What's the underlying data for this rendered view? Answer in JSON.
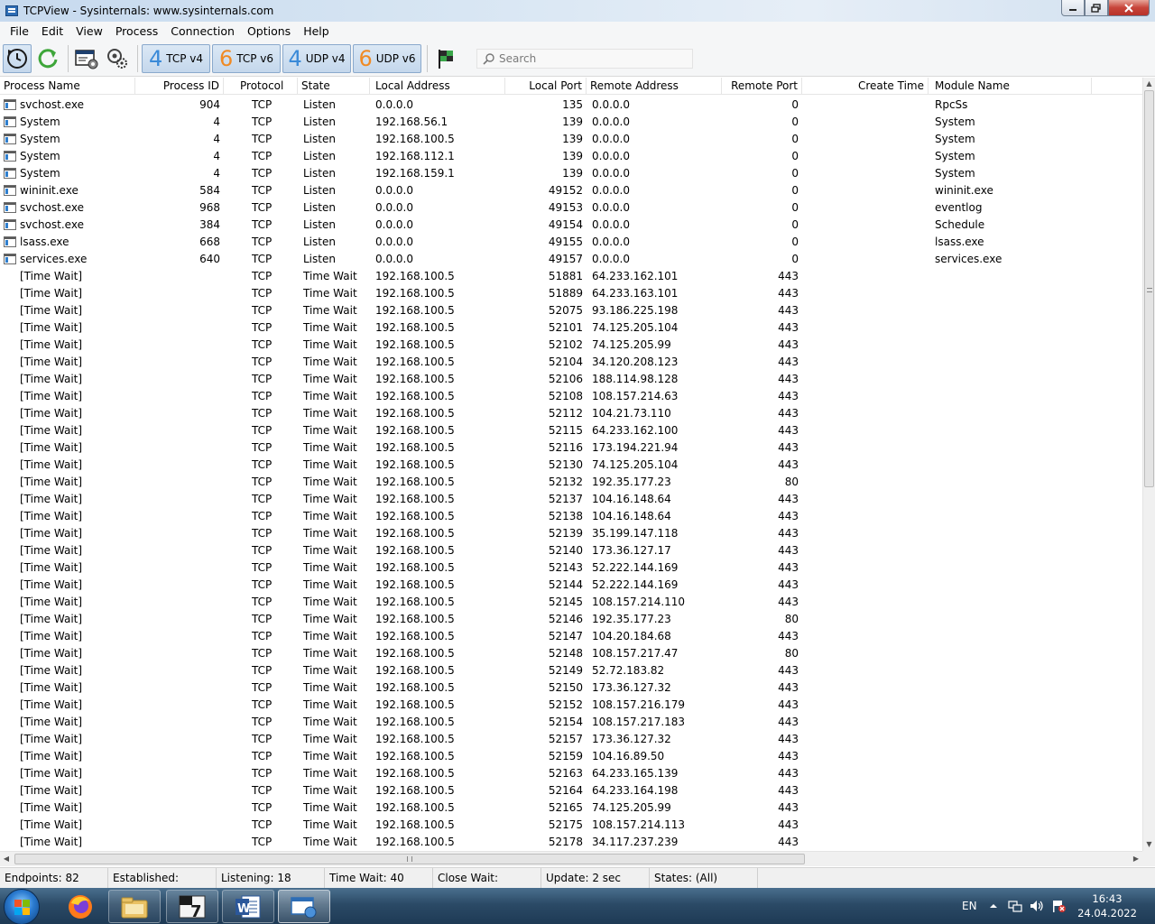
{
  "window": {
    "title": "TCPView - Sysinternals: www.sysinternals.com"
  },
  "menu": [
    "File",
    "Edit",
    "View",
    "Process",
    "Connection",
    "Options",
    "Help"
  ],
  "toolbar": {
    "tcp4": {
      "num": "4",
      "label": "TCP v4"
    },
    "tcp6": {
      "num": "6",
      "label": "TCP v6"
    },
    "udp4": {
      "num": "4",
      "label": "UDP v4"
    },
    "udp6": {
      "num": "6",
      "label": "UDP v6"
    },
    "search_placeholder": "Search"
  },
  "columns": {
    "process_name": "Process Name",
    "process_id": "Process ID",
    "protocol": "Protocol",
    "state": "State",
    "local_address": "Local Address",
    "local_port": "Local Port",
    "remote_address": "Remote Address",
    "remote_port": "Remote Port",
    "create_time": "Create Time",
    "module_name": "Module Name"
  },
  "rows": [
    {
      "icon": true,
      "name": "svchost.exe",
      "pid": "904",
      "proto": "TCP",
      "state": "Listen",
      "laddr": "0.0.0.0",
      "lport": "135",
      "raddr": "0.0.0.0",
      "rport": "0",
      "ctime": "",
      "module": "RpcSs"
    },
    {
      "icon": true,
      "name": "System",
      "pid": "4",
      "proto": "TCP",
      "state": "Listen",
      "laddr": "192.168.56.1",
      "lport": "139",
      "raddr": "0.0.0.0",
      "rport": "0",
      "ctime": "",
      "module": "System"
    },
    {
      "icon": true,
      "name": "System",
      "pid": "4",
      "proto": "TCP",
      "state": "Listen",
      "laddr": "192.168.100.5",
      "lport": "139",
      "raddr": "0.0.0.0",
      "rport": "0",
      "ctime": "",
      "module": "System"
    },
    {
      "icon": true,
      "name": "System",
      "pid": "4",
      "proto": "TCP",
      "state": "Listen",
      "laddr": "192.168.112.1",
      "lport": "139",
      "raddr": "0.0.0.0",
      "rport": "0",
      "ctime": "",
      "module": "System"
    },
    {
      "icon": true,
      "name": "System",
      "pid": "4",
      "proto": "TCP",
      "state": "Listen",
      "laddr": "192.168.159.1",
      "lport": "139",
      "raddr": "0.0.0.0",
      "rport": "0",
      "ctime": "",
      "module": "System"
    },
    {
      "icon": true,
      "name": "wininit.exe",
      "pid": "584",
      "proto": "TCP",
      "state": "Listen",
      "laddr": "0.0.0.0",
      "lport": "49152",
      "raddr": "0.0.0.0",
      "rport": "0",
      "ctime": "",
      "module": "wininit.exe"
    },
    {
      "icon": true,
      "name": "svchost.exe",
      "pid": "968",
      "proto": "TCP",
      "state": "Listen",
      "laddr": "0.0.0.0",
      "lport": "49153",
      "raddr": "0.0.0.0",
      "rport": "0",
      "ctime": "",
      "module": "eventlog"
    },
    {
      "icon": true,
      "name": "svchost.exe",
      "pid": "384",
      "proto": "TCP",
      "state": "Listen",
      "laddr": "0.0.0.0",
      "lport": "49154",
      "raddr": "0.0.0.0",
      "rport": "0",
      "ctime": "",
      "module": "Schedule"
    },
    {
      "icon": true,
      "name": "lsass.exe",
      "pid": "668",
      "proto": "TCP",
      "state": "Listen",
      "laddr": "0.0.0.0",
      "lport": "49155",
      "raddr": "0.0.0.0",
      "rport": "0",
      "ctime": "",
      "module": "lsass.exe"
    },
    {
      "icon": true,
      "name": "services.exe",
      "pid": "640",
      "proto": "TCP",
      "state": "Listen",
      "laddr": "0.0.0.0",
      "lport": "49157",
      "raddr": "0.0.0.0",
      "rport": "0",
      "ctime": "",
      "module": "services.exe"
    },
    {
      "icon": false,
      "name": "[Time Wait]",
      "pid": "",
      "proto": "TCP",
      "state": "Time Wait",
      "laddr": "192.168.100.5",
      "lport": "51881",
      "raddr": "64.233.162.101",
      "rport": "443",
      "ctime": "",
      "module": ""
    },
    {
      "icon": false,
      "name": "[Time Wait]",
      "pid": "",
      "proto": "TCP",
      "state": "Time Wait",
      "laddr": "192.168.100.5",
      "lport": "51889",
      "raddr": "64.233.163.101",
      "rport": "443",
      "ctime": "",
      "module": ""
    },
    {
      "icon": false,
      "name": "[Time Wait]",
      "pid": "",
      "proto": "TCP",
      "state": "Time Wait",
      "laddr": "192.168.100.5",
      "lport": "52075",
      "raddr": "93.186.225.198",
      "rport": "443",
      "ctime": "",
      "module": ""
    },
    {
      "icon": false,
      "name": "[Time Wait]",
      "pid": "",
      "proto": "TCP",
      "state": "Time Wait",
      "laddr": "192.168.100.5",
      "lport": "52101",
      "raddr": "74.125.205.104",
      "rport": "443",
      "ctime": "",
      "module": ""
    },
    {
      "icon": false,
      "name": "[Time Wait]",
      "pid": "",
      "proto": "TCP",
      "state": "Time Wait",
      "laddr": "192.168.100.5",
      "lport": "52102",
      "raddr": "74.125.205.99",
      "rport": "443",
      "ctime": "",
      "module": ""
    },
    {
      "icon": false,
      "name": "[Time Wait]",
      "pid": "",
      "proto": "TCP",
      "state": "Time Wait",
      "laddr": "192.168.100.5",
      "lport": "52104",
      "raddr": "34.120.208.123",
      "rport": "443",
      "ctime": "",
      "module": ""
    },
    {
      "icon": false,
      "name": "[Time Wait]",
      "pid": "",
      "proto": "TCP",
      "state": "Time Wait",
      "laddr": "192.168.100.5",
      "lport": "52106",
      "raddr": "188.114.98.128",
      "rport": "443",
      "ctime": "",
      "module": ""
    },
    {
      "icon": false,
      "name": "[Time Wait]",
      "pid": "",
      "proto": "TCP",
      "state": "Time Wait",
      "laddr": "192.168.100.5",
      "lport": "52108",
      "raddr": "108.157.214.63",
      "rport": "443",
      "ctime": "",
      "module": ""
    },
    {
      "icon": false,
      "name": "[Time Wait]",
      "pid": "",
      "proto": "TCP",
      "state": "Time Wait",
      "laddr": "192.168.100.5",
      "lport": "52112",
      "raddr": "104.21.73.110",
      "rport": "443",
      "ctime": "",
      "module": ""
    },
    {
      "icon": false,
      "name": "[Time Wait]",
      "pid": "",
      "proto": "TCP",
      "state": "Time Wait",
      "laddr": "192.168.100.5",
      "lport": "52115",
      "raddr": "64.233.162.100",
      "rport": "443",
      "ctime": "",
      "module": ""
    },
    {
      "icon": false,
      "name": "[Time Wait]",
      "pid": "",
      "proto": "TCP",
      "state": "Time Wait",
      "laddr": "192.168.100.5",
      "lport": "52116",
      "raddr": "173.194.221.94",
      "rport": "443",
      "ctime": "",
      "module": ""
    },
    {
      "icon": false,
      "name": "[Time Wait]",
      "pid": "",
      "proto": "TCP",
      "state": "Time Wait",
      "laddr": "192.168.100.5",
      "lport": "52130",
      "raddr": "74.125.205.104",
      "rport": "443",
      "ctime": "",
      "module": ""
    },
    {
      "icon": false,
      "name": "[Time Wait]",
      "pid": "",
      "proto": "TCP",
      "state": "Time Wait",
      "laddr": "192.168.100.5",
      "lport": "52132",
      "raddr": "192.35.177.23",
      "rport": "80",
      "ctime": "",
      "module": ""
    },
    {
      "icon": false,
      "name": "[Time Wait]",
      "pid": "",
      "proto": "TCP",
      "state": "Time Wait",
      "laddr": "192.168.100.5",
      "lport": "52137",
      "raddr": "104.16.148.64",
      "rport": "443",
      "ctime": "",
      "module": ""
    },
    {
      "icon": false,
      "name": "[Time Wait]",
      "pid": "",
      "proto": "TCP",
      "state": "Time Wait",
      "laddr": "192.168.100.5",
      "lport": "52138",
      "raddr": "104.16.148.64",
      "rport": "443",
      "ctime": "",
      "module": ""
    },
    {
      "icon": false,
      "name": "[Time Wait]",
      "pid": "",
      "proto": "TCP",
      "state": "Time Wait",
      "laddr": "192.168.100.5",
      "lport": "52139",
      "raddr": "35.199.147.118",
      "rport": "443",
      "ctime": "",
      "module": ""
    },
    {
      "icon": false,
      "name": "[Time Wait]",
      "pid": "",
      "proto": "TCP",
      "state": "Time Wait",
      "laddr": "192.168.100.5",
      "lport": "52140",
      "raddr": "173.36.127.17",
      "rport": "443",
      "ctime": "",
      "module": ""
    },
    {
      "icon": false,
      "name": "[Time Wait]",
      "pid": "",
      "proto": "TCP",
      "state": "Time Wait",
      "laddr": "192.168.100.5",
      "lport": "52143",
      "raddr": "52.222.144.169",
      "rport": "443",
      "ctime": "",
      "module": ""
    },
    {
      "icon": false,
      "name": "[Time Wait]",
      "pid": "",
      "proto": "TCP",
      "state": "Time Wait",
      "laddr": "192.168.100.5",
      "lport": "52144",
      "raddr": "52.222.144.169",
      "rport": "443",
      "ctime": "",
      "module": ""
    },
    {
      "icon": false,
      "name": "[Time Wait]",
      "pid": "",
      "proto": "TCP",
      "state": "Time Wait",
      "laddr": "192.168.100.5",
      "lport": "52145",
      "raddr": "108.157.214.110",
      "rport": "443",
      "ctime": "",
      "module": ""
    },
    {
      "icon": false,
      "name": "[Time Wait]",
      "pid": "",
      "proto": "TCP",
      "state": "Time Wait",
      "laddr": "192.168.100.5",
      "lport": "52146",
      "raddr": "192.35.177.23",
      "rport": "80",
      "ctime": "",
      "module": ""
    },
    {
      "icon": false,
      "name": "[Time Wait]",
      "pid": "",
      "proto": "TCP",
      "state": "Time Wait",
      "laddr": "192.168.100.5",
      "lport": "52147",
      "raddr": "104.20.184.68",
      "rport": "443",
      "ctime": "",
      "module": ""
    },
    {
      "icon": false,
      "name": "[Time Wait]",
      "pid": "",
      "proto": "TCP",
      "state": "Time Wait",
      "laddr": "192.168.100.5",
      "lport": "52148",
      "raddr": "108.157.217.47",
      "rport": "80",
      "ctime": "",
      "module": ""
    },
    {
      "icon": false,
      "name": "[Time Wait]",
      "pid": "",
      "proto": "TCP",
      "state": "Time Wait",
      "laddr": "192.168.100.5",
      "lport": "52149",
      "raddr": "52.72.183.82",
      "rport": "443",
      "ctime": "",
      "module": ""
    },
    {
      "icon": false,
      "name": "[Time Wait]",
      "pid": "",
      "proto": "TCP",
      "state": "Time Wait",
      "laddr": "192.168.100.5",
      "lport": "52150",
      "raddr": "173.36.127.32",
      "rport": "443",
      "ctime": "",
      "module": ""
    },
    {
      "icon": false,
      "name": "[Time Wait]",
      "pid": "",
      "proto": "TCP",
      "state": "Time Wait",
      "laddr": "192.168.100.5",
      "lport": "52152",
      "raddr": "108.157.216.179",
      "rport": "443",
      "ctime": "",
      "module": ""
    },
    {
      "icon": false,
      "name": "[Time Wait]",
      "pid": "",
      "proto": "TCP",
      "state": "Time Wait",
      "laddr": "192.168.100.5",
      "lport": "52154",
      "raddr": "108.157.217.183",
      "rport": "443",
      "ctime": "",
      "module": ""
    },
    {
      "icon": false,
      "name": "[Time Wait]",
      "pid": "",
      "proto": "TCP",
      "state": "Time Wait",
      "laddr": "192.168.100.5",
      "lport": "52157",
      "raddr": "173.36.127.32",
      "rport": "443",
      "ctime": "",
      "module": ""
    },
    {
      "icon": false,
      "name": "[Time Wait]",
      "pid": "",
      "proto": "TCP",
      "state": "Time Wait",
      "laddr": "192.168.100.5",
      "lport": "52159",
      "raddr": "104.16.89.50",
      "rport": "443",
      "ctime": "",
      "module": ""
    },
    {
      "icon": false,
      "name": "[Time Wait]",
      "pid": "",
      "proto": "TCP",
      "state": "Time Wait",
      "laddr": "192.168.100.5",
      "lport": "52163",
      "raddr": "64.233.165.139",
      "rport": "443",
      "ctime": "",
      "module": ""
    },
    {
      "icon": false,
      "name": "[Time Wait]",
      "pid": "",
      "proto": "TCP",
      "state": "Time Wait",
      "laddr": "192.168.100.5",
      "lport": "52164",
      "raddr": "64.233.164.198",
      "rport": "443",
      "ctime": "",
      "module": ""
    },
    {
      "icon": false,
      "name": "[Time Wait]",
      "pid": "",
      "proto": "TCP",
      "state": "Time Wait",
      "laddr": "192.168.100.5",
      "lport": "52165",
      "raddr": "74.125.205.99",
      "rport": "443",
      "ctime": "",
      "module": ""
    },
    {
      "icon": false,
      "name": "[Time Wait]",
      "pid": "",
      "proto": "TCP",
      "state": "Time Wait",
      "laddr": "192.168.100.5",
      "lport": "52175",
      "raddr": "108.157.214.113",
      "rport": "443",
      "ctime": "",
      "module": ""
    },
    {
      "icon": false,
      "name": "[Time Wait]",
      "pid": "",
      "proto": "TCP",
      "state": "Time Wait",
      "laddr": "192.168.100.5",
      "lport": "52178",
      "raddr": "34.117.237.239",
      "rport": "443",
      "ctime": "",
      "module": ""
    }
  ],
  "status": {
    "endpoints": "Endpoints: 82",
    "established": "Established:",
    "listening": "Listening: 18",
    "time_wait": "Time Wait: 40",
    "close_wait": "Close Wait:",
    "update": "Update: 2 sec",
    "states": "States: (All)"
  },
  "taskbar": {
    "language": "EN",
    "time": "16:43",
    "date": "24.04.2022"
  }
}
